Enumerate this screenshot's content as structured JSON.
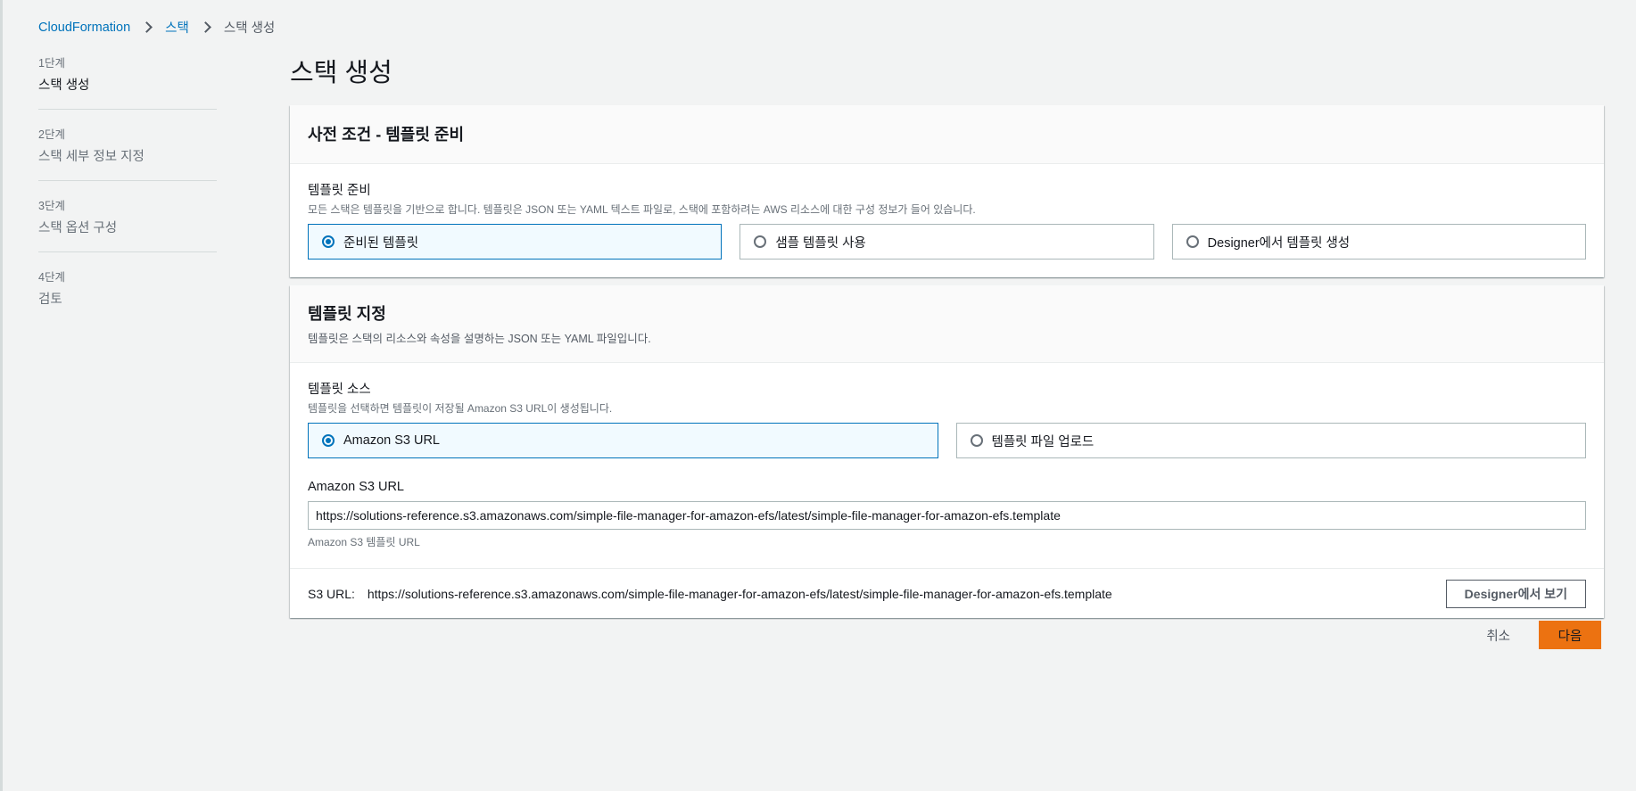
{
  "breadcrumb": {
    "root": "CloudFormation",
    "stacks": "스택",
    "current": "스택 생성"
  },
  "steps": [
    {
      "num": "1단계",
      "title": "스택 생성"
    },
    {
      "num": "2단계",
      "title": "스택 세부 정보 지정"
    },
    {
      "num": "3단계",
      "title": "스택 옵션 구성"
    },
    {
      "num": "4단계",
      "title": "검토"
    }
  ],
  "page_title": "스택 생성",
  "prereq": {
    "header": "사전 조건 - 템플릿 준비",
    "field_label": "템플릿 준비",
    "field_desc": "모든 스택은 템플릿을 기반으로 합니다. 템플릿은 JSON 또는 YAML 텍스트 파일로, 스택에 포함하려는 AWS 리소스에 대한 구성 정보가 들어 있습니다.",
    "options": [
      "준비된 템플릿",
      "샘플 템플릿 사용",
      "Designer에서 템플릿 생성"
    ],
    "selected": "준비된 템플릿"
  },
  "specify": {
    "header": "템플릿 지정",
    "header_desc": "템플릿은 스택의 리소스와 속성을 설명하는 JSON 또는 YAML 파일입니다.",
    "source_label": "템플릿 소스",
    "source_desc": "템플릿을 선택하면 템플릿이 저장될 Amazon S3 URL이 생성됩니다.",
    "source_options": [
      "Amazon S3 URL",
      "템플릿 파일 업로드"
    ],
    "selected": "Amazon S3 URL",
    "url_label": "Amazon S3 URL",
    "url_value": "https://solutions-reference.s3.amazonaws.com/simple-file-manager-for-amazon-efs/latest/simple-file-manager-for-amazon-efs.template",
    "url_constraint": "Amazon S3 템플릿 URL",
    "s3_label": "S3 URL:",
    "s3_value": "https://solutions-reference.s3.amazonaws.com/simple-file-manager-for-amazon-efs/latest/simple-file-manager-for-amazon-efs.template",
    "designer_button": "Designer에서 보기"
  },
  "actions": {
    "cancel": "취소",
    "next": "다음"
  },
  "colors": {
    "accent": "#0073bb",
    "primary_button": "#ec7211"
  }
}
